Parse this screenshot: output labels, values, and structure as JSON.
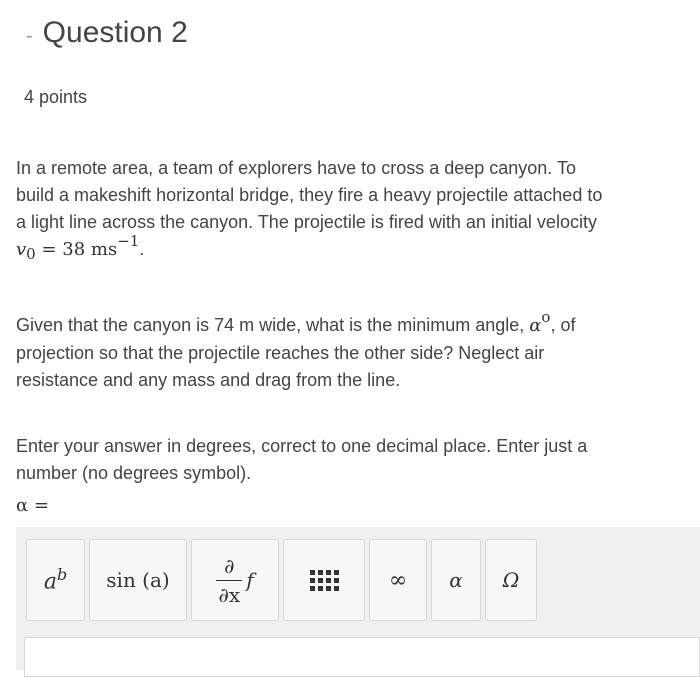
{
  "header": {
    "collapse_icon": "-",
    "title": "Question 2"
  },
  "points": "4 points",
  "question": {
    "p1_text": "In a remote area, a team of explorers have to cross a deep canyon. To build a makeshift horizontal bridge, they fire a heavy projectile attached to a light line across the canyon. The projectile is fired with an initial velocity ",
    "p1_var": "v",
    "p1_var_sub": "0",
    "p1_eq": " = 38 ms",
    "p1_exp": "−1",
    "p1_end": ".",
    "p2_start": "Given that the canyon is 74 m wide, what is the minimum angle, ",
    "p2_alpha": "α",
    "p2_deg": "o",
    "p2_end": ", of projection so that the projectile reaches the other side? Neglect air resistance and any mass and drag from the line.",
    "p3": "Enter your answer in degrees, correct to one decimal place. Enter just a number (no degrees symbol).",
    "answer_label": "α ="
  },
  "toolbar": {
    "power": {
      "base": "a",
      "exp": "b"
    },
    "sin": "sin (a)",
    "partial": {
      "num": "∂",
      "den": "∂x",
      "f": "f"
    },
    "infinity": "∞",
    "alpha": "α",
    "omega": "Ω"
  }
}
